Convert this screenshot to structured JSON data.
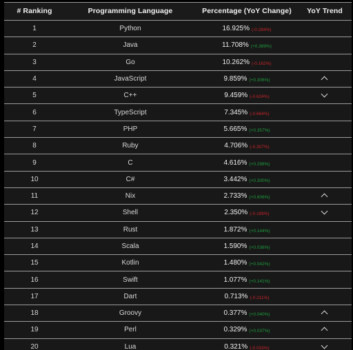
{
  "table": {
    "columns": [
      {
        "key": "rank",
        "label": "# Ranking"
      },
      {
        "key": "lang",
        "label": "Programming Language"
      },
      {
        "key": "pct",
        "label": "Percentage (YoY Change)"
      },
      {
        "key": "trend",
        "label": "YoY Trend"
      }
    ],
    "colors": {
      "background": "#000000",
      "row_background": "#181818",
      "header_background": "#1a1a1a",
      "border": "#9b9b9b",
      "text": "#e2e2e2",
      "positive": "#1f9d3f",
      "negative": "#c9252b"
    },
    "rows": [
      {
        "rank": "1",
        "lang": "Python",
        "pct": "16.925%",
        "change": "(-0.284%)",
        "dir": "down",
        "trend": ""
      },
      {
        "rank": "2",
        "lang": "Java",
        "pct": "11.708%",
        "change": "(+0.389%)",
        "dir": "up",
        "trend": ""
      },
      {
        "rank": "3",
        "lang": "Go",
        "pct": "10.262%",
        "change": "(-0.162%)",
        "dir": "down",
        "trend": ""
      },
      {
        "rank": "4",
        "lang": "JavaScript",
        "pct": "9.859%",
        "change": "(+0.306%)",
        "dir": "up",
        "trend": "chevron-up-icon"
      },
      {
        "rank": "5",
        "lang": "C++",
        "pct": "9.459%",
        "change": "(-0.624%)",
        "dir": "down",
        "trend": "chevron-down-icon"
      },
      {
        "rank": "6",
        "lang": "TypeScript",
        "pct": "7.345%",
        "change": "(-0.664%)",
        "dir": "down",
        "trend": ""
      },
      {
        "rank": "7",
        "lang": "PHP",
        "pct": "5.665%",
        "change": "(+0.357%)",
        "dir": "up",
        "trend": ""
      },
      {
        "rank": "8",
        "lang": "Ruby",
        "pct": "4.706%",
        "change": "(-0.307%)",
        "dir": "down",
        "trend": ""
      },
      {
        "rank": "9",
        "lang": "C",
        "pct": "4.616%",
        "change": "(+0.298%)",
        "dir": "up",
        "trend": ""
      },
      {
        "rank": "10",
        "lang": "C#",
        "pct": "3.442%",
        "change": "(+0.300%)",
        "dir": "up",
        "trend": ""
      },
      {
        "rank": "11",
        "lang": "Nix",
        "pct": "2.733%",
        "change": "(+0.606%)",
        "dir": "up",
        "trend": "chevron-up-icon"
      },
      {
        "rank": "12",
        "lang": "Shell",
        "pct": "2.350%",
        "change": "(-0.189%)",
        "dir": "down",
        "trend": "chevron-down-icon"
      },
      {
        "rank": "13",
        "lang": "Rust",
        "pct": "1.872%",
        "change": "(+0.144%)",
        "dir": "up",
        "trend": ""
      },
      {
        "rank": "14",
        "lang": "Scala",
        "pct": "1.590%",
        "change": "(+0.036%)",
        "dir": "up",
        "trend": ""
      },
      {
        "rank": "15",
        "lang": "Kotlin",
        "pct": "1.480%",
        "change": "(+0.042%)",
        "dir": "up",
        "trend": ""
      },
      {
        "rank": "16",
        "lang": "Swift",
        "pct": "1.077%",
        "change": "(+0.141%)",
        "dir": "up",
        "trend": ""
      },
      {
        "rank": "17",
        "lang": "Dart",
        "pct": "0.713%",
        "change": "(-0.211%)",
        "dir": "down",
        "trend": ""
      },
      {
        "rank": "18",
        "lang": "Groovy",
        "pct": "0.377%",
        "change": "(+0.040%)",
        "dir": "up",
        "trend": "chevron-up-icon"
      },
      {
        "rank": "19",
        "lang": "Perl",
        "pct": "0.329%",
        "change": "(+0.037%)",
        "dir": "up",
        "trend": "chevron-up-icon"
      },
      {
        "rank": "20",
        "lang": "Lua",
        "pct": "0.321%",
        "change": "(-0.033%)",
        "dir": "down",
        "trend": "chevron-down-icon"
      }
    ]
  }
}
